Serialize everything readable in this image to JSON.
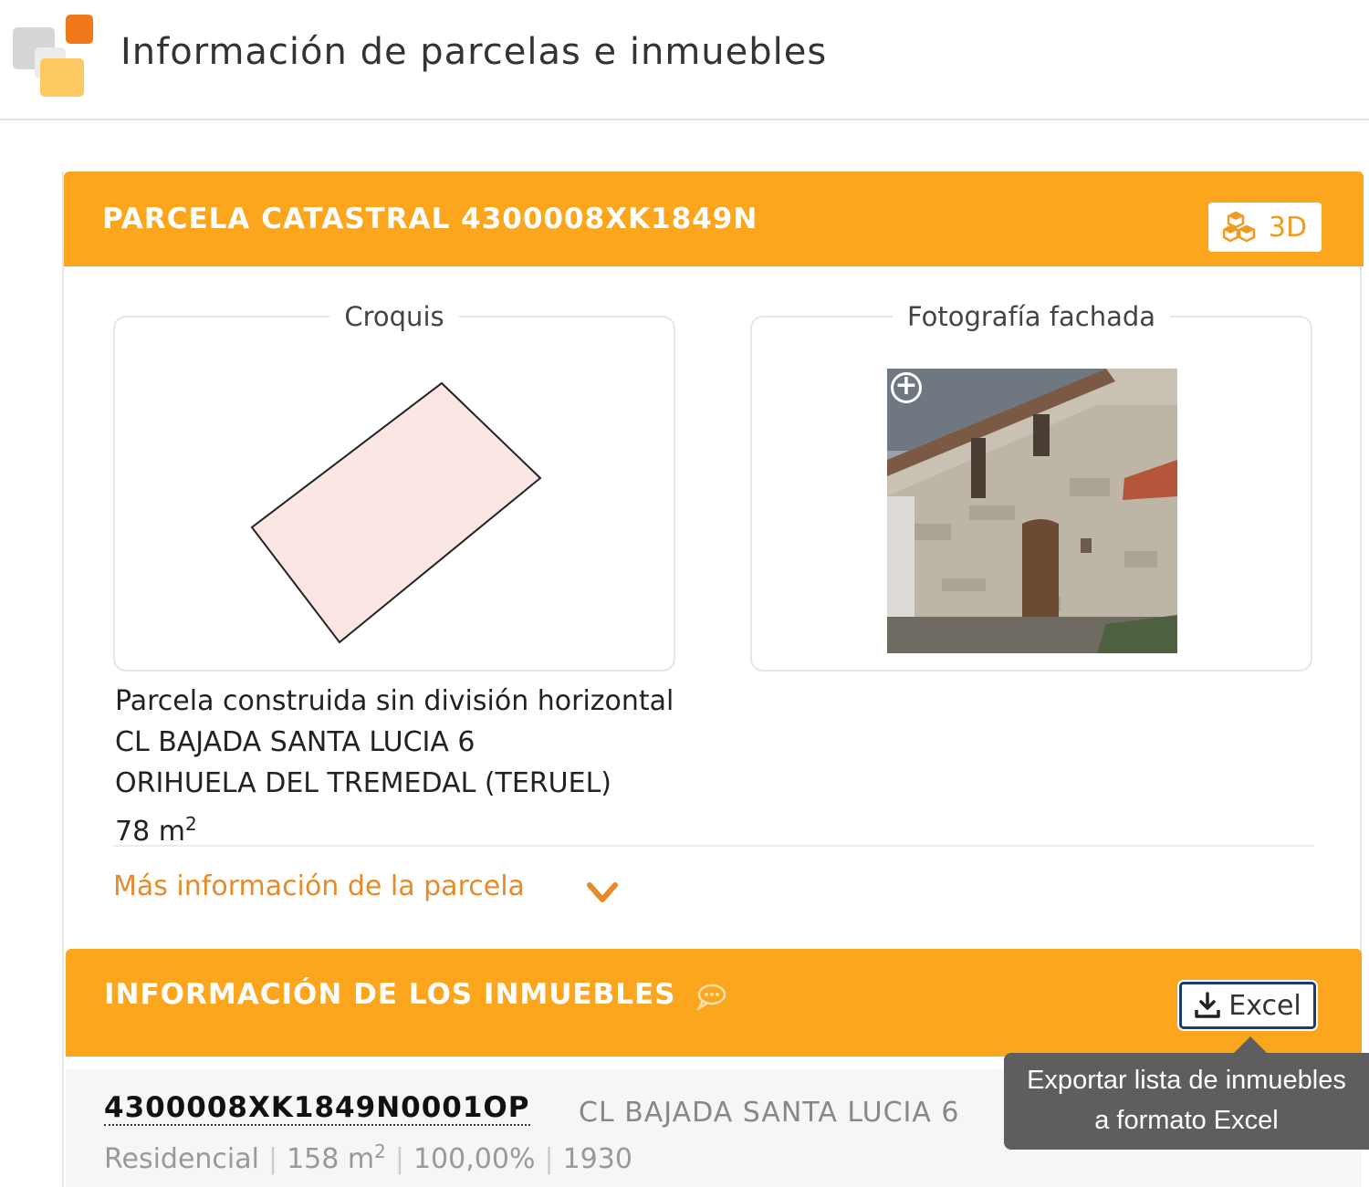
{
  "header": {
    "title": "Información de parcelas e inmuebles"
  },
  "parcel": {
    "band_title": "PARCELA CATASTRAL 4300008XK1849N",
    "btn_3d_label": "3D",
    "croquis_label": "Croquis",
    "foto_label": "Fotografía fachada",
    "zoom_icon": "zoom-plus-icon",
    "type": "Parcela construida sin división horizontal",
    "address": "CL BAJADA SANTA LUCIA 6",
    "municipality": "ORIHUELA DEL TREMEDAL (TERUEL)",
    "area_value": "78 m",
    "area_unit_sup": "2",
    "more_link": "Más información de la parcela"
  },
  "inmuebles": {
    "band_title": "INFORMACIÓN DE LOS INMUEBLES",
    "excel_label": "Excel",
    "tooltip_line1": "Exportar lista de inmuebles",
    "tooltip_line2": "a formato Excel",
    "rows": [
      {
        "ref": "4300008XK1849N0001OP",
        "address": "CL BAJADA SANTA LUCIA 6",
        "use": "Residencial",
        "area": "158 m",
        "area_sup": "2",
        "share": "100,00%",
        "year": "1930"
      }
    ]
  },
  "colors": {
    "accent": "#fba61d",
    "link": "#e68a2a",
    "excel_border": "#1d3b6e"
  }
}
